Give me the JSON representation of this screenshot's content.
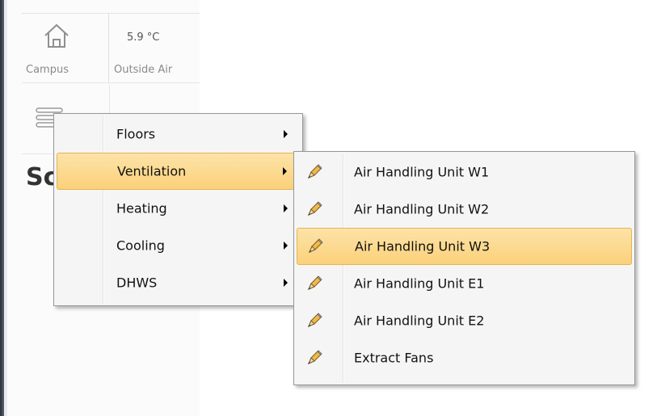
{
  "campus_tile": {
    "label": "Campus",
    "icon": "home-icon"
  },
  "outside_air_tile": {
    "value": "5.9 °C",
    "label": "Outside Air"
  },
  "menu_icon": "hamburger-icon",
  "heading_fragment": "Sc",
  "main_menu": {
    "items": [
      {
        "label": "Floors",
        "has_submenu": true,
        "selected": false
      },
      {
        "label": "Ventilation",
        "has_submenu": true,
        "selected": true
      },
      {
        "label": "Heating",
        "has_submenu": true,
        "selected": false
      },
      {
        "label": "Cooling",
        "has_submenu": true,
        "selected": false
      },
      {
        "label": "DHWS",
        "has_submenu": true,
        "selected": false
      }
    ]
  },
  "ventilation_submenu": {
    "item_icon": "pencil-icon",
    "items": [
      {
        "label": "Air Handling Unit W1",
        "selected": false
      },
      {
        "label": "Air Handling Unit W2",
        "selected": false
      },
      {
        "label": "Air Handling Unit W3",
        "selected": true
      },
      {
        "label": "Air Handling Unit E1",
        "selected": false
      },
      {
        "label": "Air Handling Unit E2",
        "selected": false
      },
      {
        "label": "Extract Fans",
        "selected": false
      }
    ]
  },
  "colors": {
    "highlight_top": "#fde3a8",
    "highlight_bottom": "#fbd17a",
    "highlight_border": "#e5b452",
    "menu_background": "#f5f5f5"
  }
}
